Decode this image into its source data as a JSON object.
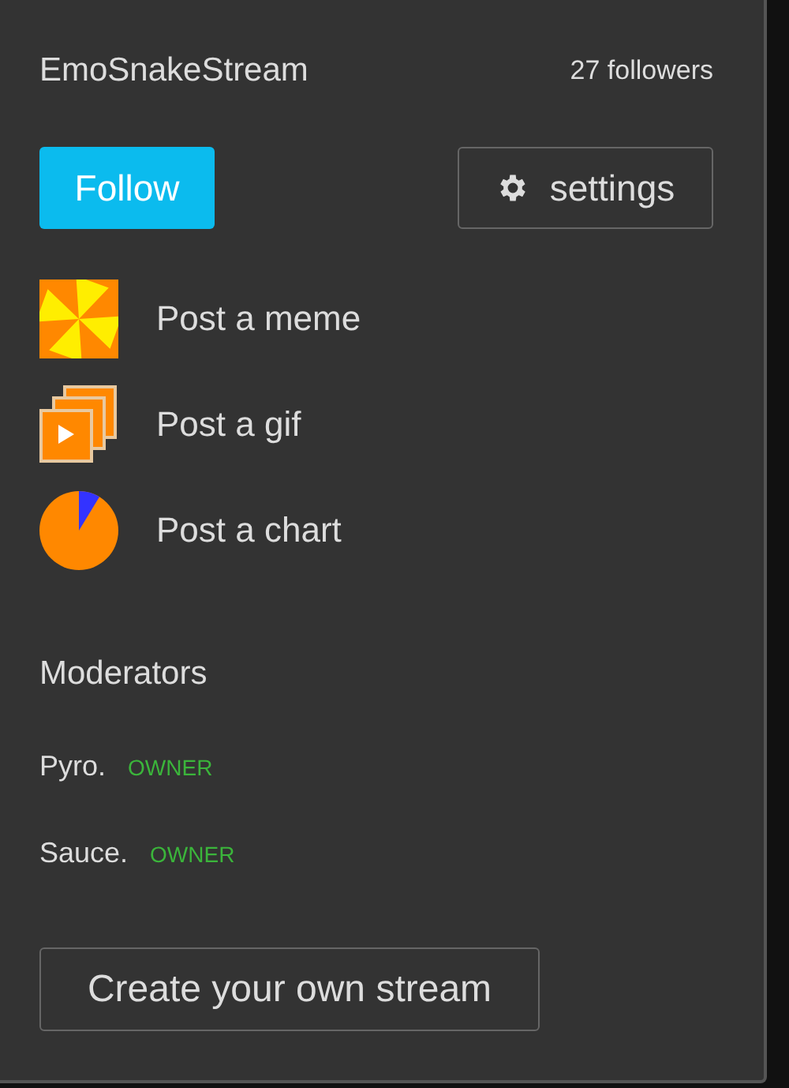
{
  "stream": {
    "name": "EmoSnakeStream",
    "followers": "27 followers"
  },
  "follow_button": "Follow",
  "settings_button": "settings",
  "post_actions": [
    {
      "kind": "meme",
      "label": "Post a meme"
    },
    {
      "kind": "gif",
      "label": "Post a gif"
    },
    {
      "kind": "chart",
      "label": "Post a chart"
    }
  ],
  "moderators": {
    "heading": "Moderators",
    "items": [
      {
        "name": "Pyro.",
        "role": "OWNER"
      },
      {
        "name": "Sauce.",
        "role": "OWNER"
      }
    ]
  },
  "create_button": "Create your own stream"
}
